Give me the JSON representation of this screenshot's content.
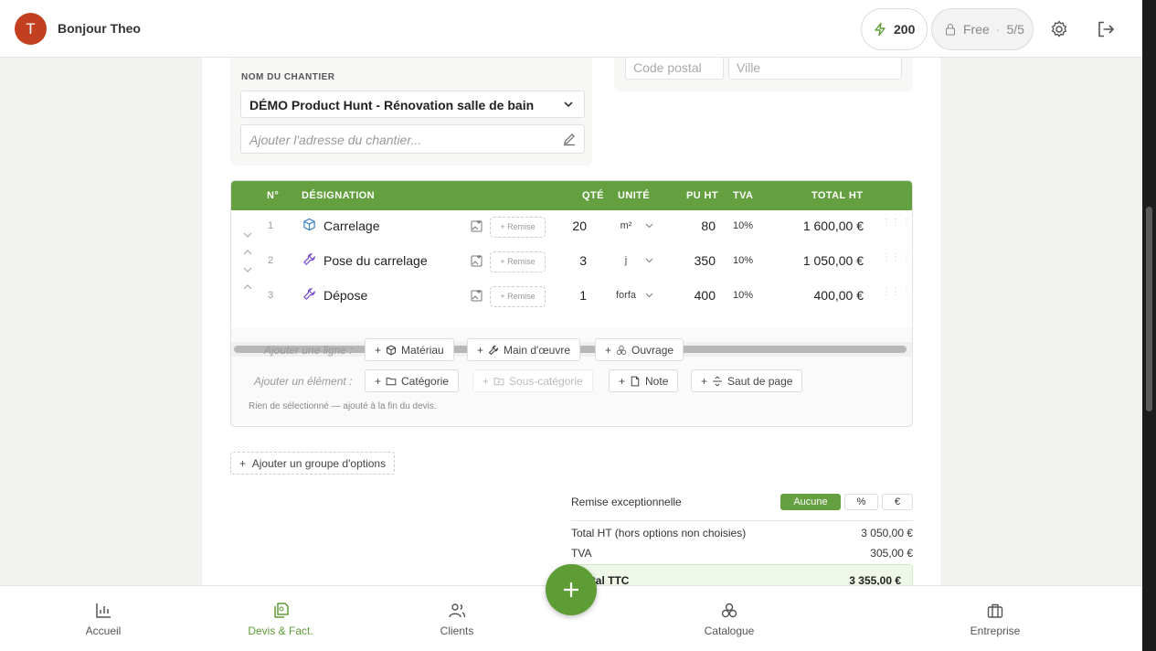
{
  "header": {
    "avatar_initial": "T",
    "greeting": "Bonjour Theo",
    "credits": "200",
    "plan": "Free",
    "plan_usage": "5/5",
    "icons": [
      "bolt-icon",
      "lock-icon",
      "gear-icon",
      "logout-icon"
    ]
  },
  "address": {
    "postal_placeholder": "Code postal",
    "city_placeholder": "Ville"
  },
  "chantier": {
    "label": "NOM DU CHANTIER",
    "value": "DÉMO Product Hunt - Rénovation salle de bain",
    "address_placeholder": "Ajouter l'adresse du chantier..."
  },
  "table": {
    "headers": {
      "num": "N°",
      "designation": "DÉSIGNATION",
      "qte": "QTÉ",
      "unite": "UNITÉ",
      "pu_ht": "PU HT",
      "tva": "TVA",
      "total_ht": "TOTAL HT"
    },
    "remise_label": "+ Remise",
    "rows": [
      {
        "num": "1",
        "designation": "Carrelage",
        "type_icon": "cube-icon",
        "qte": "20",
        "unite": "m²",
        "pu": "80",
        "tva": "10%",
        "total": "1 600,00 €"
      },
      {
        "num": "2",
        "designation": "Pose du carrelage",
        "type_icon": "wrench-icon",
        "qte": "3",
        "unite": "j",
        "pu": "350",
        "tva": "10%",
        "total": "1 050,00 €"
      },
      {
        "num": "3",
        "designation": "Dépose",
        "type_icon": "wrench-icon",
        "qte": "1",
        "unite": "forfa",
        "pu": "400",
        "tva": "10%",
        "total": "400,00 €"
      }
    ]
  },
  "add_line": {
    "label": "Ajouter une ligne :",
    "materiau": "Matériau",
    "main_oeuvre": "Main d'œuvre",
    "ouvrage": "Ouvrage"
  },
  "add_element": {
    "label": "Ajouter un élément :",
    "categorie": "Catégorie",
    "sous_categorie": "Sous-catégorie",
    "note": "Note",
    "saut_page": "Saut de page"
  },
  "hint": "Rien de sélectionné — ajouté à la fin du devis.",
  "options_button": "Ajouter un groupe d'options",
  "totals": {
    "remise_label": "Remise exceptionnelle",
    "remise_options": [
      "Aucune",
      "%",
      "€"
    ],
    "total_ht_label": "Total HT (hors options non choisies)",
    "total_ht": "3 050,00 €",
    "tva_label": "TVA",
    "tva": "305,00 €",
    "ttc_label": "Total TTC",
    "ttc": "3 355,00 €"
  },
  "nav": {
    "accueil": "Accueil",
    "devis": "Devis & Fact.",
    "clients": "Clients",
    "catalogue": "Catalogue",
    "entreprise": "Entreprise"
  },
  "colors": {
    "accent": "#64a03f",
    "avatar": "#c2401f"
  }
}
